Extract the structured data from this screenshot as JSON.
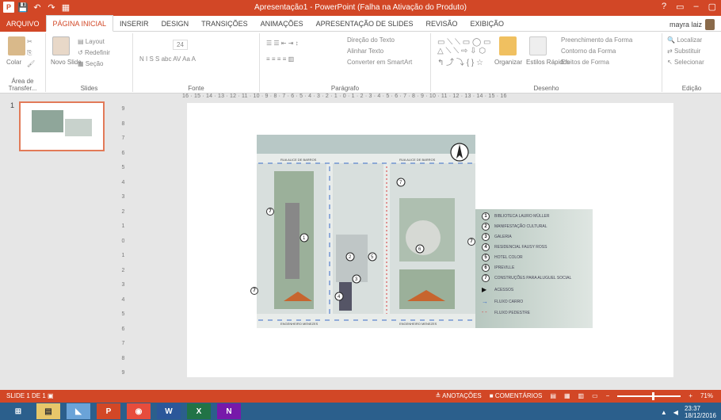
{
  "window": {
    "title": "Apresentação1 - PowerPoint (Falha na Ativação do Produto)",
    "controls": [
      "?",
      "▭",
      "–",
      "▢"
    ]
  },
  "quick_access": [
    "P",
    "💾",
    "↶",
    "↷",
    "▦"
  ],
  "tabs": [
    {
      "label": "ARQUIVO"
    },
    {
      "label": "PÁGINA INICIAL"
    },
    {
      "label": "INSERIR"
    },
    {
      "label": "DESIGN"
    },
    {
      "label": "TRANSIÇÕES"
    },
    {
      "label": "ANIMAÇÕES"
    },
    {
      "label": "APRESENTAÇÃO DE SLIDES"
    },
    {
      "label": "REVISÃO"
    },
    {
      "label": "EXIBIÇÃO"
    }
  ],
  "user": {
    "name": "mayra laiz"
  },
  "ribbon": {
    "clipboard": {
      "label": "Área de Transfer...",
      "paste": "Colar"
    },
    "slides": {
      "label": "Slides",
      "new_slide": "Novo Slide",
      "layout": "Layout",
      "reset": "Redefinir",
      "section": "Seção"
    },
    "font": {
      "label": "Fonte",
      "size": "24",
      "buttons": "N  I  S  S  abc  AV  Aa  A"
    },
    "paragraph": {
      "label": "Parágrafo",
      "text_direction": "Direção do Texto",
      "align_text": "Alinhar Texto",
      "smartart": "Converter em SmartArt"
    },
    "drawing": {
      "label": "Desenho",
      "arrange": "Organizar",
      "quick_styles": "Estilos Rápidos",
      "shape_fill": "Preenchimento da Forma",
      "shape_outline": "Contorno da Forma",
      "shape_effects": "Efeitos de Forma"
    },
    "editing": {
      "label": "Edição",
      "find": "Localizar",
      "replace": "Substituir",
      "select": "Selecionar"
    }
  },
  "ruler": {
    "text": "16 · 15 · 14 · 13 · 12 · 11 · 10 · 9 · 8 · 7 · 6 · 5 · 4 · 3 · 2 · 1 · 0 · 1 · 2 · 3 · 4 · 5 · 6 · 7 · 8 · 9 · 10 · 11 · 12 · 13 · 14 · 15 · 16"
  },
  "vruler": [
    "9",
    "8",
    "7",
    "6",
    "5",
    "4",
    "3",
    "2",
    "1",
    "0",
    "1",
    "2",
    "3",
    "4",
    "5",
    "6",
    "7",
    "8",
    "9"
  ],
  "thumbnail": {
    "number": "1"
  },
  "slide": {
    "map": {
      "street_top_left": "RUA ALICE DE BARROS",
      "street_top_right": "RUA ALICE DE BARROS",
      "street_bottom_left": "ENGENHEIRO MENEZES",
      "street_bottom_right": "ENGENHEIRO MENEZES",
      "markers": [
        "1",
        "2",
        "3",
        "4",
        "5",
        "6",
        "7"
      ]
    },
    "legend": [
      {
        "n": "1",
        "text": "BIBLIOTECA LAURO MÜLLER"
      },
      {
        "n": "2",
        "text": "MANIFESTAÇÃO CULTURAL"
      },
      {
        "n": "3",
        "text": "GALERIA"
      },
      {
        "n": "4",
        "text": "RESIDENCIAL FAUSY ROSS"
      },
      {
        "n": "5",
        "text": "HOTEL COLOR"
      },
      {
        "n": "6",
        "text": "IPREVILLE"
      },
      {
        "n": "7",
        "text": "CONSTRUÇÕES PARA ALUGUEL SOCIAL"
      },
      {
        "n": "▶",
        "text": "ACESSOS"
      },
      {
        "n": "→",
        "text": "FLUXO CARRO"
      },
      {
        "n": "- -",
        "text": "FLUXO PEDESTRE"
      }
    ]
  },
  "status": {
    "slide": "SLIDE 1 DE 1",
    "notes": "ANOTAÇÕES",
    "comments": "COMENTÁRIOS",
    "zoom": "71%",
    "zoom_level": 0.55
  },
  "taskbar": {
    "apps": [
      "⊞",
      "▤",
      "◣",
      "P",
      "◉",
      "W",
      "X",
      "N"
    ],
    "time": "23:37",
    "date": "18/12/2016"
  },
  "colors": {
    "accent": "#d24726",
    "taskbar": "#2b5f8c"
  }
}
